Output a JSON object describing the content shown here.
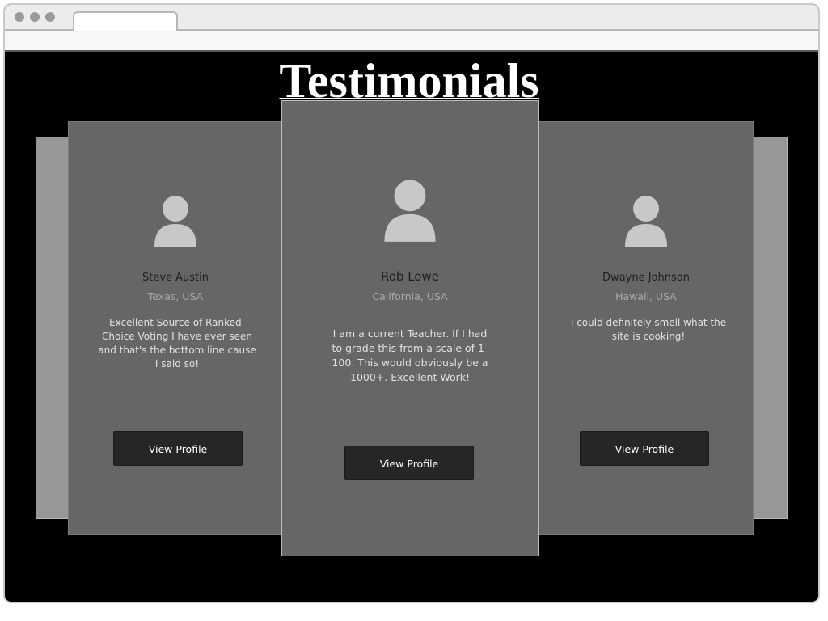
{
  "page": {
    "title": "Testimonials"
  },
  "testimonials": [
    {
      "name": "Steve Austin",
      "location": "Texas, USA",
      "quote": "Excellent Source of Ranked-Choice Voting I have ever seen and that's the bottom line cause I said so!",
      "button_label": "View Profile"
    },
    {
      "name": "Rob Lowe",
      "location": "California, USA",
      "quote": "I am a current Teacher. If I had to grade this from a scale of 1-100. This would obviously be a 1000+. Excellent Work!",
      "button_label": "View Profile"
    },
    {
      "name": "Dwayne Johnson",
      "location": "Hawaii, USA",
      "quote": "I could definitely smell what the site is cooking!",
      "button_label": "View Profile"
    }
  ],
  "colors": {
    "page_background": "#000000",
    "card_background": "#666666",
    "back_panel": "#979797",
    "button_background": "#262626",
    "avatar": "#c8c8c8"
  },
  "icons": {
    "avatar": "user-avatar-icon"
  }
}
